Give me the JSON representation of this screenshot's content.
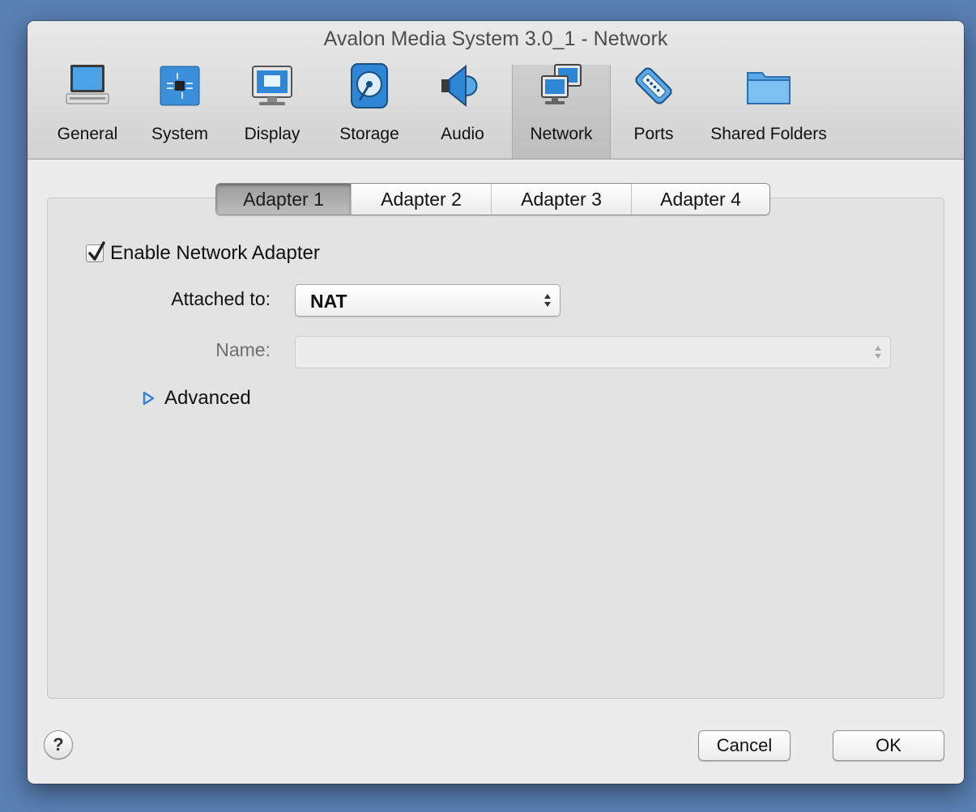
{
  "window": {
    "title": "Avalon Media System 3.0_1 - Network"
  },
  "toolbar": {
    "items": [
      {
        "label": "General",
        "icon": "monitor-icon"
      },
      {
        "label": "System",
        "icon": "chip-icon"
      },
      {
        "label": "Display",
        "icon": "display-icon"
      },
      {
        "label": "Storage",
        "icon": "disk-icon"
      },
      {
        "label": "Audio",
        "icon": "speaker-icon"
      },
      {
        "label": "Network",
        "icon": "network-icon",
        "selected": true
      },
      {
        "label": "Ports",
        "icon": "serial-port-icon"
      },
      {
        "label": "Shared Folders",
        "icon": "folder-icon"
      }
    ]
  },
  "tabs": [
    "Adapter 1",
    "Adapter 2",
    "Adapter 3",
    "Adapter 4"
  ],
  "selected_tab": "Adapter 1",
  "form": {
    "enable_label": "Enable Network Adapter",
    "enable_checked": true,
    "attached_label": "Attached to:",
    "attached_value": "NAT",
    "name_label": "Name:",
    "name_value": "",
    "advanced_label": "Advanced"
  },
  "buttons": {
    "help": "?",
    "cancel": "Cancel",
    "ok": "OK"
  },
  "colors": {
    "accent": "#3b82d6",
    "desktop": "#5a7fb3"
  }
}
